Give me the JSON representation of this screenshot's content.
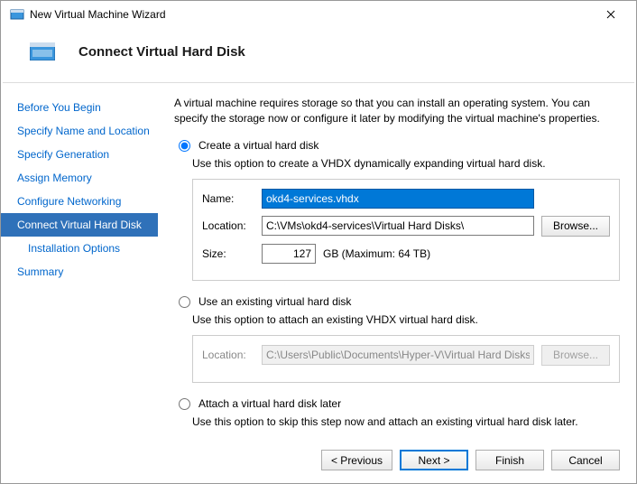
{
  "titlebar": {
    "title": "New Virtual Machine Wizard"
  },
  "header": {
    "title": "Connect Virtual Hard Disk"
  },
  "sidebar": {
    "items": [
      {
        "label": "Before You Begin"
      },
      {
        "label": "Specify Name and Location"
      },
      {
        "label": "Specify Generation"
      },
      {
        "label": "Assign Memory"
      },
      {
        "label": "Configure Networking"
      },
      {
        "label": "Connect Virtual Hard Disk"
      },
      {
        "label": "Installation Options"
      },
      {
        "label": "Summary"
      }
    ]
  },
  "content": {
    "description": "A virtual machine requires storage so that you can install an operating system. You can specify the storage now or configure it later by modifying the virtual machine's properties.",
    "opt_create": {
      "label": "Create a virtual hard disk",
      "desc": "Use this option to create a VHDX dynamically expanding virtual hard disk.",
      "name_label": "Name:",
      "name_value": "okd4-services.vhdx",
      "location_label": "Location:",
      "location_value": "C:\\VMs\\okd4-services\\Virtual Hard Disks\\",
      "browse_label": "Browse...",
      "size_label": "Size:",
      "size_value": "127",
      "size_unit": "GB (Maximum: 64 TB)"
    },
    "opt_existing": {
      "label": "Use an existing virtual hard disk",
      "desc": "Use this option to attach an existing VHDX virtual hard disk.",
      "location_label": "Location:",
      "location_value": "C:\\Users\\Public\\Documents\\Hyper-V\\Virtual Hard Disks\\",
      "browse_label": "Browse..."
    },
    "opt_later": {
      "label": "Attach a virtual hard disk later",
      "desc": "Use this option to skip this step now and attach an existing virtual hard disk later."
    }
  },
  "footer": {
    "previous": "< Previous",
    "next": "Next >",
    "finish": "Finish",
    "cancel": "Cancel"
  }
}
